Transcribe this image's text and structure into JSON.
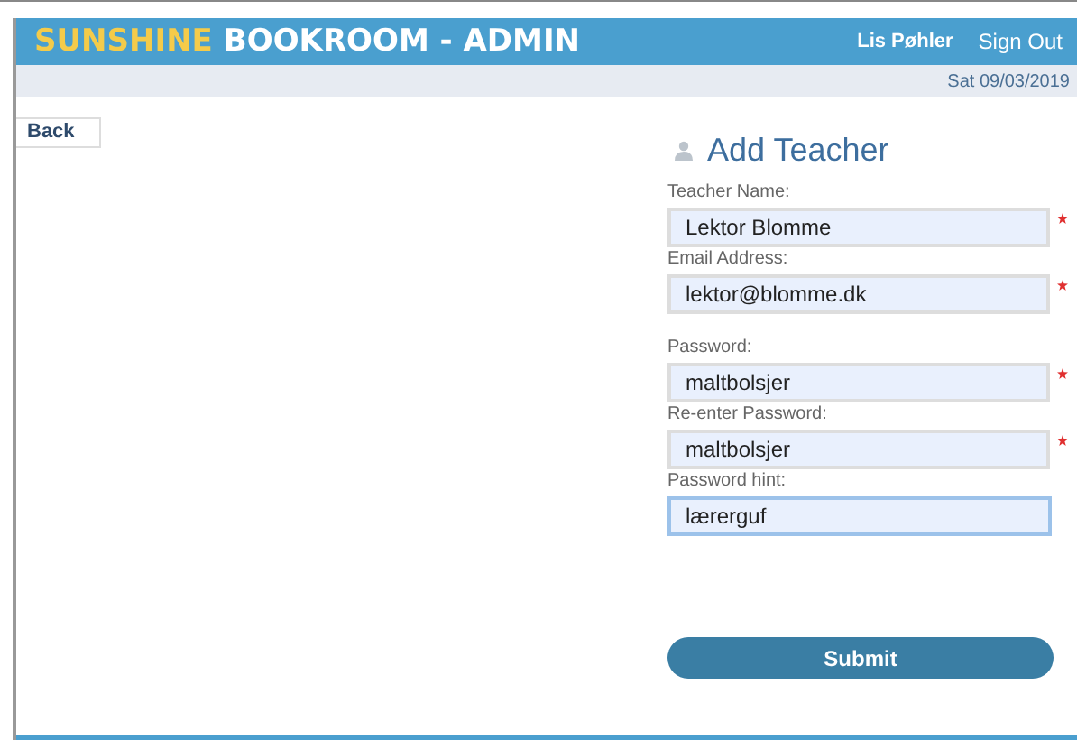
{
  "header": {
    "brand_highlight": "SUNSHINE",
    "brand_rest": "BOOKROOM - ADMIN",
    "user": "Lis Pøhler",
    "sign_out": "Sign Out"
  },
  "date": "Sat 09/03/2019",
  "back": "Back",
  "form": {
    "title": "Add Teacher",
    "fields": [
      {
        "label": "Teacher Name:",
        "value": "Lektor Blomme",
        "required": true,
        "focused": false
      },
      {
        "label": "Email Address:",
        "value": "lektor@blomme.dk",
        "required": true,
        "focused": false
      },
      {
        "label": "Password:",
        "value": "maltbolsjer",
        "required": true,
        "focused": false
      },
      {
        "label": "Re-enter Password:",
        "value": "maltbolsjer",
        "required": true,
        "focused": false
      },
      {
        "label": "Password hint:",
        "value": "lærerguf",
        "required": false,
        "focused": true
      }
    ],
    "submit": "Submit"
  }
}
